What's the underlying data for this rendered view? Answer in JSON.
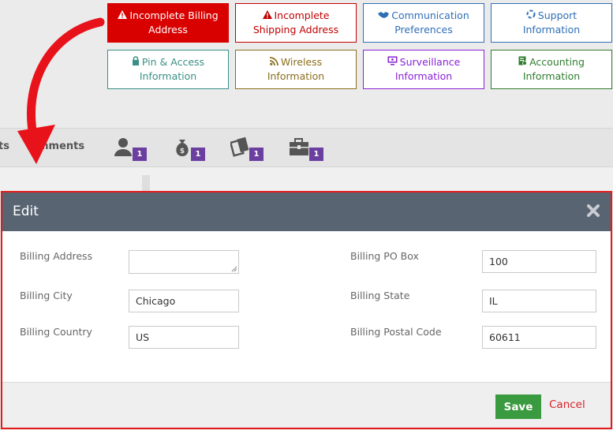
{
  "status_buttons": [
    {
      "id": "billing",
      "icon": "warning-icon",
      "label": "Incomplete Billing Address",
      "active": true
    },
    {
      "id": "shipping",
      "icon": "warning-icon",
      "label": "Incomplete Shipping Address"
    },
    {
      "id": "communication",
      "icon": "handshake-icon",
      "label": "Communication Preferences"
    },
    {
      "id": "support",
      "icon": "life-ring-icon",
      "label": "Support Information"
    },
    {
      "id": "pin",
      "icon": "lock-icon",
      "label": "Pin & Access Information"
    },
    {
      "id": "wireless",
      "icon": "wifi-rss-icon",
      "label": "Wireless Information"
    },
    {
      "id": "surveillance",
      "icon": "monitor-icon",
      "label": "Surveillance Information"
    },
    {
      "id": "accounting",
      "icon": "ledger-icon",
      "label": "Accounting Information"
    }
  ],
  "toolbar": {
    "tab_fragment_left": "ts",
    "tab_fragment_comments": "mments",
    "counts": [
      {
        "icon": "user-icon",
        "count": "1"
      },
      {
        "icon": "money-bag-icon",
        "count": "1"
      },
      {
        "icon": "tickets-icon",
        "count": "1"
      },
      {
        "icon": "briefcase-icon",
        "count": "1"
      }
    ]
  },
  "modal": {
    "title": "Edit",
    "fields": {
      "billing_address": {
        "label": "Billing Address",
        "value": ""
      },
      "billing_city": {
        "label": "Billing City",
        "value": "Chicago"
      },
      "billing_country": {
        "label": "Billing Country",
        "value": "US"
      },
      "billing_po_box": {
        "label": "Billing PO Box",
        "value": "100"
      },
      "billing_state": {
        "label": "Billing State",
        "value": "IL"
      },
      "billing_postal_code": {
        "label": "Billing Postal Code",
        "value": "60611"
      }
    },
    "save_label": "Save",
    "cancel_label": "Cancel"
  },
  "colors": {
    "active_alert": "#d90000",
    "modal_border": "#e41b1b",
    "modal_header": "#586472",
    "save_green": "#3a9a3f",
    "cancel_red": "#d9222a",
    "badge_purple": "#6b3fa0"
  }
}
